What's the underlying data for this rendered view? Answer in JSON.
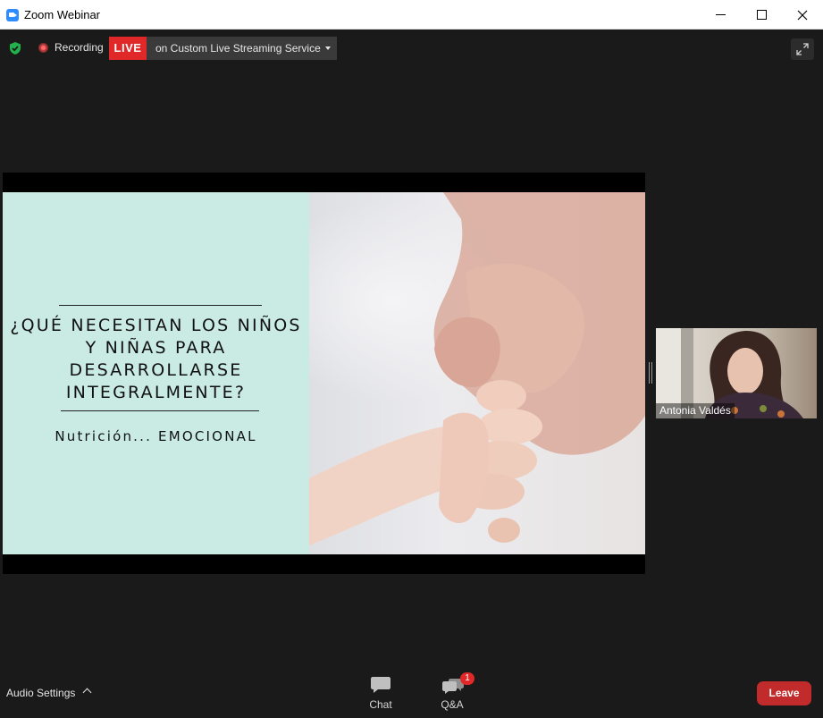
{
  "window": {
    "title": "Zoom Webinar"
  },
  "top_bar": {
    "recording_label": "Recording",
    "live_badge": "LIVE",
    "stream_service": "on Custom Live Streaming Service"
  },
  "slide": {
    "title": "¿QUÉ NECESITAN LOS NIÑOS Y NIÑAS PARA DESARROLLARSE INTEGRALMENTE?",
    "subtitle": "Nutrición... EMOCIONAL"
  },
  "participant": {
    "name": "Antonia Valdés"
  },
  "toolbar": {
    "audio_settings": "Audio Settings",
    "chat_label": "Chat",
    "qa_label": "Q&A",
    "qa_badge": "1",
    "leave_label": "Leave"
  },
  "colors": {
    "background": "#1a1a1a",
    "live_red": "#e02828",
    "leave_red": "#c22b2b",
    "slide_panel": "#c9ebe3",
    "security_green": "#21b24b"
  },
  "icons": [
    "zoom-app-icon",
    "minimize-icon",
    "maximize-icon",
    "close-icon",
    "shield-check-icon",
    "recording-icon",
    "dropdown-caret-icon",
    "fullscreen-icon",
    "chevron-up-icon",
    "chat-icon",
    "qa-icon"
  ]
}
